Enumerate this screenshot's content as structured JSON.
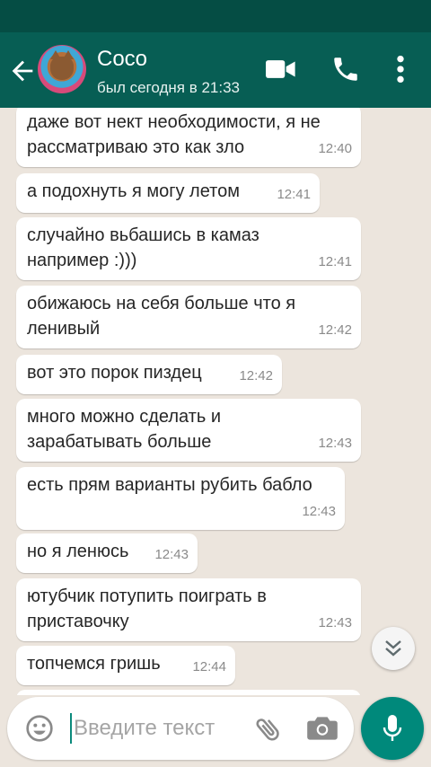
{
  "header": {
    "contact_name": "Coco",
    "last_seen": "был сегодня в 21:33",
    "icons": [
      "back-arrow-icon",
      "avatar",
      "video-call-icon",
      "phone-icon",
      "more-vert-icon"
    ]
  },
  "messages": [
    {
      "text": "даже вот нект необходимости, я не\nрассматриваю это как зло",
      "time": "12:40"
    },
    {
      "text": "а подохнуть я могу летом",
      "time": "12:41"
    },
    {
      "text": "случайно вьбашись в камаз\nнапример :)))",
      "time": "12:41"
    },
    {
      "text": "обижаюсь на себя больше что я\nленивый",
      "time": "12:42"
    },
    {
      "text": "вот это порок пиздец",
      "time": "12:42"
    },
    {
      "text": "много можно сделать и\nзарабатывать больше",
      "time": "12:43"
    },
    {
      "text": "есть прям варианты рубить бабло",
      "time": "12:43"
    },
    {
      "text": "но я ленюсь",
      "time": "12:43"
    },
    {
      "text": "ютубчик потупить поиграть в\nприставочку",
      "time": "12:43"
    },
    {
      "text": "топчемся гришь",
      "time": "12:44"
    }
  ],
  "composer": {
    "placeholder": "Введите текст",
    "value": ""
  },
  "colors": {
    "header": "#075e54",
    "statusbar": "#054d44",
    "accent": "#00897b",
    "chat_bg": "#ece5dd"
  }
}
